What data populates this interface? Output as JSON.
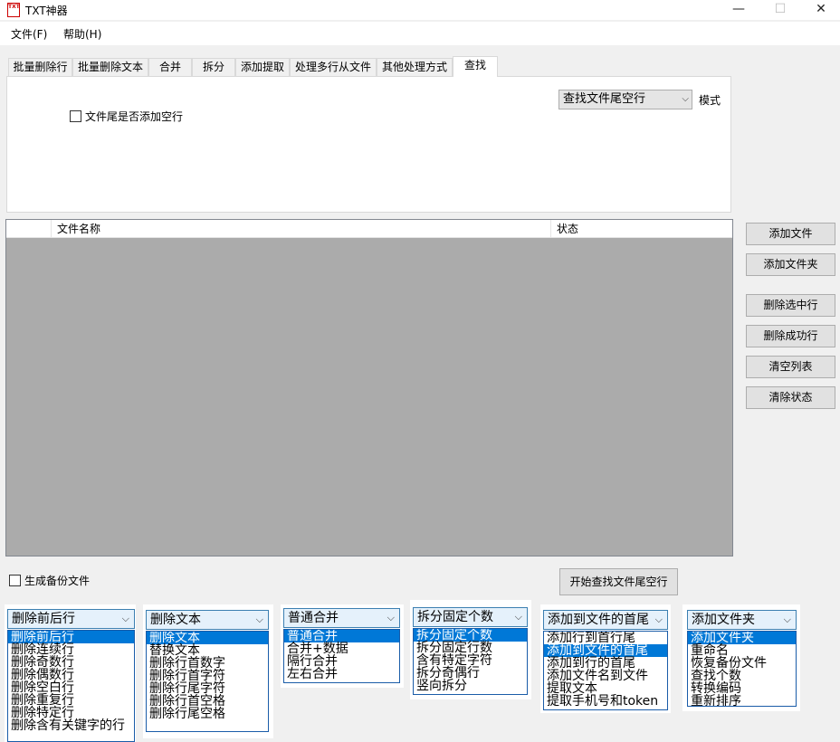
{
  "window": {
    "title": "TXT神器",
    "icon_text": "TXT",
    "minimize": "—",
    "maximize": "☐",
    "close": "✕"
  },
  "menu": {
    "file": "文件(F)",
    "help": "帮助(H)"
  },
  "tabs": [
    "批量删除行",
    "批量删除文本",
    "合并",
    "拆分",
    "添加提取",
    "处理多行从文件",
    "其他处理方式",
    "查找"
  ],
  "find_panel": {
    "append_empty_line_label": "文件尾是否添加空行",
    "mode_value": "查找文件尾空行",
    "mode_label": "模式"
  },
  "file_list": {
    "columns": [
      "",
      "文件名称",
      "状态"
    ]
  },
  "side_buttons": [
    "添加文件",
    "添加文件夹",
    "删除选中行",
    "删除成功行",
    "清空列表",
    "清除状态"
  ],
  "backup_label": "生成备份文件",
  "start_button": "开始查找文件尾空行",
  "dropdowns": [
    {
      "value": "删除前后行",
      "options": [
        "删除前后行",
        "删除连续行",
        "删除奇数行",
        "删除偶数行",
        "删除空白行",
        "删除重复行",
        "删除特定行",
        "删除含有关键字的行"
      ],
      "selected": 0
    },
    {
      "value": "删除文本",
      "options": [
        "删除文本",
        "替换文本",
        "删除行首数字",
        "删除行首字符",
        "删除行尾字符",
        "删除行首空格",
        "删除行尾空格"
      ],
      "selected": 0
    },
    {
      "value": "普通合并",
      "options": [
        "普通合并",
        "合并+数据",
        "隔行合并",
        "左右合并"
      ],
      "selected": 0
    },
    {
      "value": "拆分固定个数",
      "options": [
        "拆分固定个数",
        "拆分固定行数",
        "含有特定字符",
        "拆分奇偶行",
        "竖向拆分"
      ],
      "selected": 0
    },
    {
      "value": "添加到文件的首尾",
      "options": [
        "添加行到首行尾",
        "添加到文件的首尾",
        "添加到行的首尾",
        "添加文件名到文件",
        "提取文本",
        "提取手机号和token"
      ],
      "selected": 1
    },
    {
      "value": "添加文件夹",
      "options": [
        "添加文件夹",
        "重命名",
        "恢复备份文件",
        "查找个数",
        "转换编码",
        "重新排序"
      ],
      "selected": 0
    }
  ]
}
